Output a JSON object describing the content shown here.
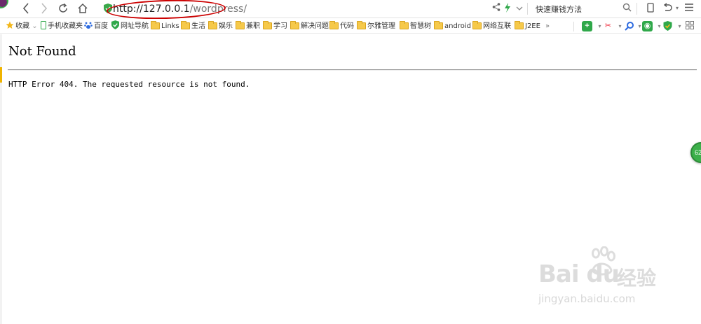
{
  "browser": {
    "url_host": "http://127.0.0.1",
    "url_path": "/wordpress/",
    "search_hint": "快速赚钱方法"
  },
  "bookmarks": [
    {
      "label": "收藏",
      "icon": "star-icon"
    },
    {
      "label": "手机收藏夹",
      "icon": "phone-icon"
    },
    {
      "label": "百度",
      "icon": "baidu-paw-icon"
    },
    {
      "label": "网址导航",
      "icon": "shield-check-icon"
    },
    {
      "label": "Links",
      "icon": "folder-icon"
    },
    {
      "label": "生活",
      "icon": "folder-icon"
    },
    {
      "label": "娱乐",
      "icon": "folder-icon"
    },
    {
      "label": "兼职",
      "icon": "folder-icon"
    },
    {
      "label": "学习",
      "icon": "folder-icon"
    },
    {
      "label": "解决问题",
      "icon": "folder-icon"
    },
    {
      "label": "代码",
      "icon": "folder-icon"
    },
    {
      "label": "尔雅管理",
      "icon": "folder-icon"
    },
    {
      "label": "智慧树",
      "icon": "folder-icon"
    },
    {
      "label": "android",
      "icon": "folder-icon"
    },
    {
      "label": "网络互联",
      "icon": "folder-icon"
    },
    {
      "label": "J2EE",
      "icon": "folder-icon"
    }
  ],
  "page": {
    "heading": "Not Found",
    "message": "HTTP Error 404. The requested resource is not found."
  },
  "float_badge": "62",
  "watermark": {
    "brand": "Bai du",
    "cn": "经验",
    "site": "jingyan.baidu.com"
  },
  "colors": {
    "annotation_red": "#cc0000",
    "green_accent": "#3cb04a",
    "folder_yellow": "#f6c94a"
  }
}
